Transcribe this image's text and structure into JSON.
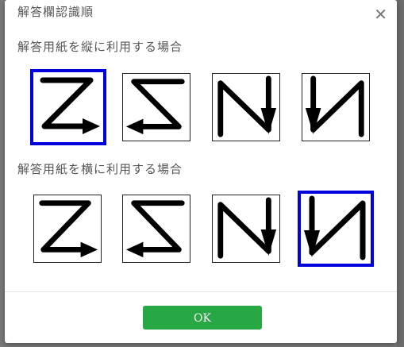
{
  "dialog": {
    "title": "解答欄認識順",
    "close_symbol": "✕",
    "ok_label": "OK"
  },
  "sections": [
    {
      "label": "解答用紙を縦に利用する場合",
      "selected_option": "z"
    },
    {
      "label": "解答用紙を横に利用する場合",
      "selected_option": "n"
    }
  ],
  "options": [
    {
      "id": "z",
      "icon": "z-order-icon"
    },
    {
      "id": "mirror-z",
      "icon": "mirrored-z-order-icon"
    },
    {
      "id": "mirror-n",
      "icon": "mirrored-n-order-icon"
    },
    {
      "id": "n",
      "icon": "n-order-icon"
    }
  ],
  "colors": {
    "selection_border": "#0000dd",
    "ok_button": "#28a745"
  }
}
